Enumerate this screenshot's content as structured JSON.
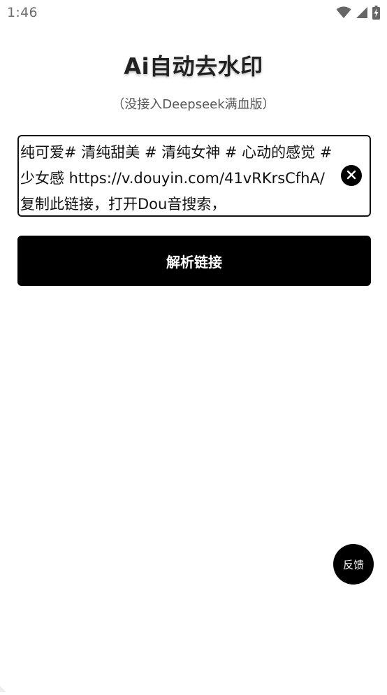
{
  "status_bar": {
    "time": "1:46",
    "icons": [
      "wifi-icon",
      "signal-icon",
      "battery-charging-icon"
    ]
  },
  "header": {
    "title": "Ai自动去水印",
    "subtitle": "（没接入Deepseek满血版）"
  },
  "link_input": {
    "value": "纯可爱# 清纯甜美 # 清纯女神 # 心动的感觉 # 少女感  https://v.douyin.com/41vRKrsCfhA/ 复制此链接，打开Dou音搜索，",
    "clear_icon": "close-circle-icon"
  },
  "actions": {
    "parse_label": "解析链接",
    "feedback_label": "反馈"
  },
  "colors": {
    "accent": "#000000",
    "background": "#ffffff",
    "status_text": "#6b6b6b"
  }
}
